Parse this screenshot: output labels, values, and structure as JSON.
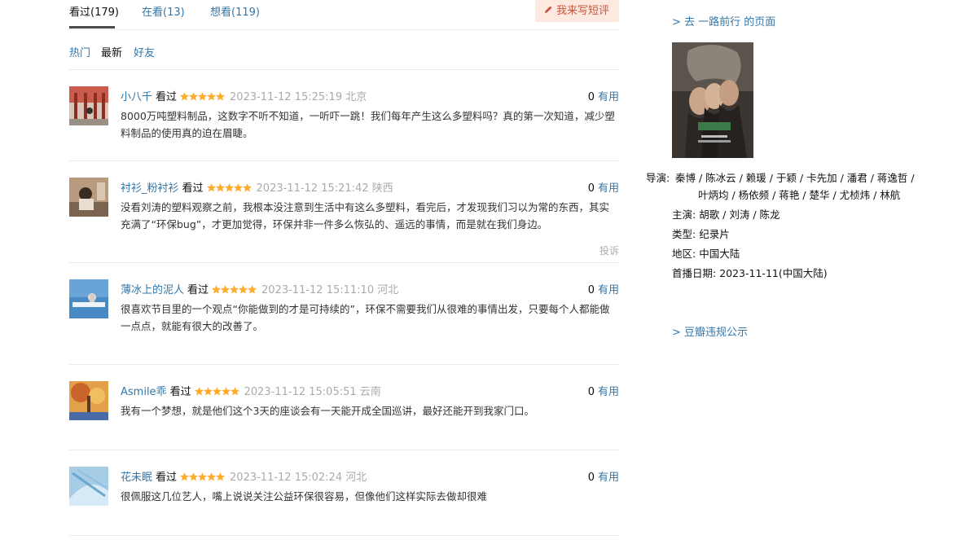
{
  "tabs": [
    {
      "label": "看过(179)",
      "active": true
    },
    {
      "label": "在看(13)",
      "active": false
    },
    {
      "label": "想看(119)",
      "active": false
    }
  ],
  "write_button": {
    "label": "我来写短评",
    "icon": "pencil-icon"
  },
  "sort": {
    "hot": "热门",
    "latest": "最新",
    "friends": "好友"
  },
  "comments": [
    {
      "user": "小八千",
      "status": "看过",
      "rating": 5,
      "time": "2023-11-12 15:25:19",
      "location": "北京",
      "useful_count": "0",
      "useful_label": "有用",
      "text": "8000万吨塑料制品，这数字不听不知道，一听吓一跳！我们每年产生这么多塑料吗？真的第一次知道，减少塑料制品的使用真的迫在眉睫。"
    },
    {
      "user": "衬衫_粉衬衫",
      "status": "看过",
      "rating": 5,
      "time": "2023-11-12 15:21:42",
      "location": "陕西",
      "useful_count": "0",
      "useful_label": "有用",
      "text": "没看刘涛的塑料观察之前，我根本没注意到生活中有这么多塑料，看完后，才发现我们习以为常的东西，其实充满了“环保bug”，才更加觉得，环保并非一件多么恢弘的、遥远的事情，而是就在我们身边。",
      "report": "投诉"
    },
    {
      "user": "薄冰上的泥人",
      "status": "看过",
      "rating": 5,
      "time": "2023-11-12 15:11:10",
      "location": "河北",
      "useful_count": "0",
      "useful_label": "有用",
      "text": "很喜欢节目里的一个观点“你能做到的才是可持续的”，环保不需要我们从很难的事情出发，只要每个人都能做一点点，就能有很大的改善了。"
    },
    {
      "user": "Asmile乖",
      "status": "看过",
      "rating": 5,
      "time": "2023-11-12 15:05:51",
      "location": "云南",
      "useful_count": "0",
      "useful_label": "有用",
      "text": "我有一个梦想，就是他们这个3天的座谈会有一天能开成全国巡讲，最好还能开到我家门口。"
    },
    {
      "user": "花未眠",
      "status": "看过",
      "rating": 5,
      "time": "2023-11-12 15:02:24",
      "location": "河北",
      "useful_count": "0",
      "useful_label": "有用",
      "text": "很佩服这几位艺人，嘴上说说关注公益环保很容易，但像他们这样实际去做却很难"
    }
  ],
  "side": {
    "goto_link": "> 去 一路前行 的页面",
    "info": [
      {
        "key": "导演:",
        "value": "秦博 / 陈冰云 / 赖瑗 / 于颖 / 卡先加 / 潘君 / 蒋逸哲 / 叶炳均 / 杨依频 / 蒋艳 / 楚华 / 尤桢炜 / 林航"
      },
      {
        "key": "主演:",
        "value": "胡歌 / 刘涛 / 陈龙"
      },
      {
        "key": "类型:",
        "value": "纪录片"
      },
      {
        "key": "地区:",
        "value": "中国大陆"
      },
      {
        "key": "首播日期:",
        "value": "2023-11-11(中国大陆)"
      }
    ],
    "report_link": "> 豆瓣违规公示"
  },
  "colors": {
    "link": "#3377aa",
    "star": "#ffac2d",
    "meta": "#aaaaaa",
    "write_bg": "#fde9df",
    "write_fg": "#c8553d"
  }
}
